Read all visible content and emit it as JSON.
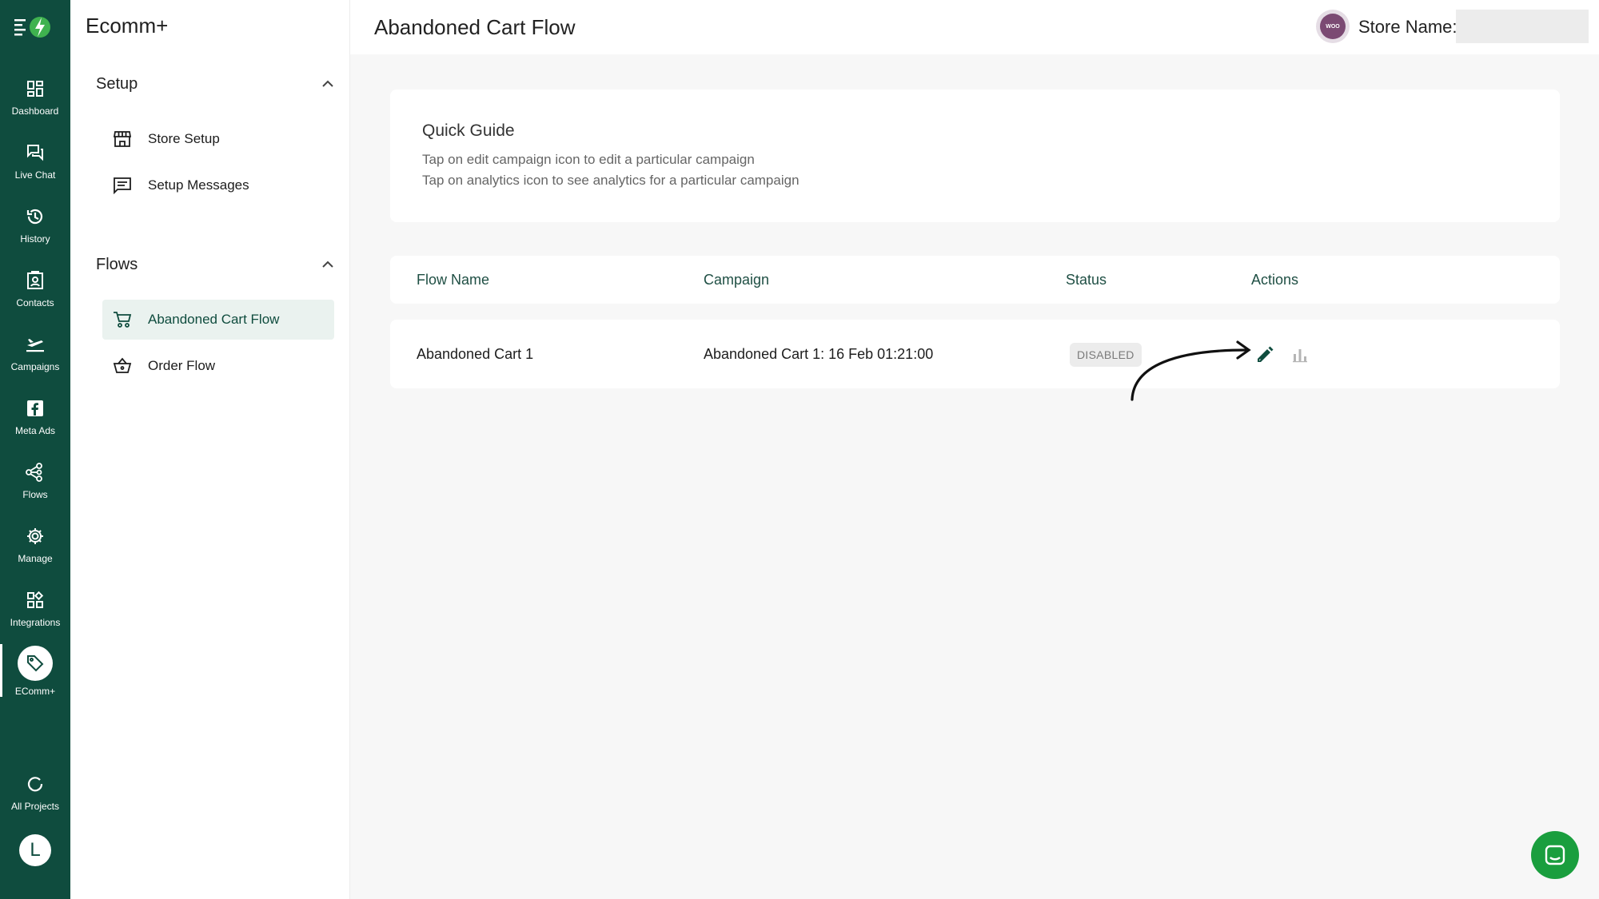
{
  "rail": {
    "items": [
      {
        "label": "Dashboard",
        "icon": "dashboard-icon"
      },
      {
        "label": "Live Chat",
        "icon": "chat-icon"
      },
      {
        "label": "History",
        "icon": "history-icon"
      },
      {
        "label": "Contacts",
        "icon": "contacts-icon"
      },
      {
        "label": "Campaigns",
        "icon": "campaigns-icon"
      },
      {
        "label": "Meta Ads",
        "icon": "facebook-icon"
      },
      {
        "label": "Flows",
        "icon": "flows-icon"
      },
      {
        "label": "Manage",
        "icon": "gear-icon"
      },
      {
        "label": "Integrations",
        "icon": "integrations-icon"
      },
      {
        "label": "EComm+",
        "icon": "tag-icon"
      }
    ],
    "all_projects": "All Projects",
    "avatar_letter": "L"
  },
  "subnav": {
    "title": "Ecomm+",
    "setup": {
      "label": "Setup",
      "items": [
        {
          "label": "Store Setup",
          "icon": "store-icon"
        },
        {
          "label": "Setup Messages",
          "icon": "message-icon"
        }
      ]
    },
    "flows": {
      "label": "Flows",
      "items": [
        {
          "label": "Abandoned Cart Flow",
          "icon": "cart-icon"
        },
        {
          "label": "Order Flow",
          "icon": "basket-icon"
        }
      ]
    }
  },
  "header": {
    "title": "Abandoned Cart Flow",
    "store_label": "Store Name:",
    "store_logo_text": "WOO"
  },
  "guide": {
    "title": "Quick Guide",
    "lines": [
      "Tap on edit campaign icon to edit a particular campaign",
      "Tap on analytics icon to see analytics for a particular campaign"
    ]
  },
  "table": {
    "columns": [
      "Flow Name",
      "Campaign",
      "Status",
      "Actions"
    ],
    "rows": [
      {
        "flow_name": "Abandoned Cart 1",
        "campaign": "Abandoned Cart 1: 16 Feb 01:21:00",
        "status": "DISABLED"
      }
    ]
  },
  "colors": {
    "brand": "#0f4c3e",
    "chat_fab": "#1a9e3e"
  }
}
